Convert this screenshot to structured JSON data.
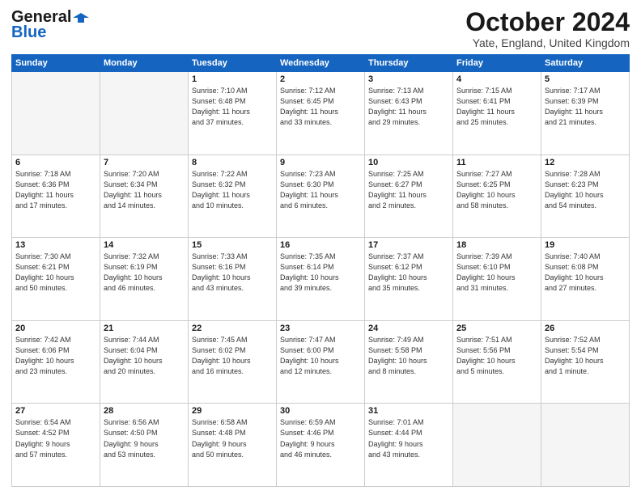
{
  "header": {
    "logo_general": "General",
    "logo_blue": "Blue",
    "month": "October 2024",
    "location": "Yate, England, United Kingdom"
  },
  "days_of_week": [
    "Sunday",
    "Monday",
    "Tuesday",
    "Wednesday",
    "Thursday",
    "Friday",
    "Saturday"
  ],
  "weeks": [
    [
      {
        "day": "",
        "info": ""
      },
      {
        "day": "",
        "info": ""
      },
      {
        "day": "1",
        "info": "Sunrise: 7:10 AM\nSunset: 6:48 PM\nDaylight: 11 hours\nand 37 minutes."
      },
      {
        "day": "2",
        "info": "Sunrise: 7:12 AM\nSunset: 6:45 PM\nDaylight: 11 hours\nand 33 minutes."
      },
      {
        "day": "3",
        "info": "Sunrise: 7:13 AM\nSunset: 6:43 PM\nDaylight: 11 hours\nand 29 minutes."
      },
      {
        "day": "4",
        "info": "Sunrise: 7:15 AM\nSunset: 6:41 PM\nDaylight: 11 hours\nand 25 minutes."
      },
      {
        "day": "5",
        "info": "Sunrise: 7:17 AM\nSunset: 6:39 PM\nDaylight: 11 hours\nand 21 minutes."
      }
    ],
    [
      {
        "day": "6",
        "info": "Sunrise: 7:18 AM\nSunset: 6:36 PM\nDaylight: 11 hours\nand 17 minutes."
      },
      {
        "day": "7",
        "info": "Sunrise: 7:20 AM\nSunset: 6:34 PM\nDaylight: 11 hours\nand 14 minutes."
      },
      {
        "day": "8",
        "info": "Sunrise: 7:22 AM\nSunset: 6:32 PM\nDaylight: 11 hours\nand 10 minutes."
      },
      {
        "day": "9",
        "info": "Sunrise: 7:23 AM\nSunset: 6:30 PM\nDaylight: 11 hours\nand 6 minutes."
      },
      {
        "day": "10",
        "info": "Sunrise: 7:25 AM\nSunset: 6:27 PM\nDaylight: 11 hours\nand 2 minutes."
      },
      {
        "day": "11",
        "info": "Sunrise: 7:27 AM\nSunset: 6:25 PM\nDaylight: 10 hours\nand 58 minutes."
      },
      {
        "day": "12",
        "info": "Sunrise: 7:28 AM\nSunset: 6:23 PM\nDaylight: 10 hours\nand 54 minutes."
      }
    ],
    [
      {
        "day": "13",
        "info": "Sunrise: 7:30 AM\nSunset: 6:21 PM\nDaylight: 10 hours\nand 50 minutes."
      },
      {
        "day": "14",
        "info": "Sunrise: 7:32 AM\nSunset: 6:19 PM\nDaylight: 10 hours\nand 46 minutes."
      },
      {
        "day": "15",
        "info": "Sunrise: 7:33 AM\nSunset: 6:16 PM\nDaylight: 10 hours\nand 43 minutes."
      },
      {
        "day": "16",
        "info": "Sunrise: 7:35 AM\nSunset: 6:14 PM\nDaylight: 10 hours\nand 39 minutes."
      },
      {
        "day": "17",
        "info": "Sunrise: 7:37 AM\nSunset: 6:12 PM\nDaylight: 10 hours\nand 35 minutes."
      },
      {
        "day": "18",
        "info": "Sunrise: 7:39 AM\nSunset: 6:10 PM\nDaylight: 10 hours\nand 31 minutes."
      },
      {
        "day": "19",
        "info": "Sunrise: 7:40 AM\nSunset: 6:08 PM\nDaylight: 10 hours\nand 27 minutes."
      }
    ],
    [
      {
        "day": "20",
        "info": "Sunrise: 7:42 AM\nSunset: 6:06 PM\nDaylight: 10 hours\nand 23 minutes."
      },
      {
        "day": "21",
        "info": "Sunrise: 7:44 AM\nSunset: 6:04 PM\nDaylight: 10 hours\nand 20 minutes."
      },
      {
        "day": "22",
        "info": "Sunrise: 7:45 AM\nSunset: 6:02 PM\nDaylight: 10 hours\nand 16 minutes."
      },
      {
        "day": "23",
        "info": "Sunrise: 7:47 AM\nSunset: 6:00 PM\nDaylight: 10 hours\nand 12 minutes."
      },
      {
        "day": "24",
        "info": "Sunrise: 7:49 AM\nSunset: 5:58 PM\nDaylight: 10 hours\nand 8 minutes."
      },
      {
        "day": "25",
        "info": "Sunrise: 7:51 AM\nSunset: 5:56 PM\nDaylight: 10 hours\nand 5 minutes."
      },
      {
        "day": "26",
        "info": "Sunrise: 7:52 AM\nSunset: 5:54 PM\nDaylight: 10 hours\nand 1 minute."
      }
    ],
    [
      {
        "day": "27",
        "info": "Sunrise: 6:54 AM\nSunset: 4:52 PM\nDaylight: 9 hours\nand 57 minutes."
      },
      {
        "day": "28",
        "info": "Sunrise: 6:56 AM\nSunset: 4:50 PM\nDaylight: 9 hours\nand 53 minutes."
      },
      {
        "day": "29",
        "info": "Sunrise: 6:58 AM\nSunset: 4:48 PM\nDaylight: 9 hours\nand 50 minutes."
      },
      {
        "day": "30",
        "info": "Sunrise: 6:59 AM\nSunset: 4:46 PM\nDaylight: 9 hours\nand 46 minutes."
      },
      {
        "day": "31",
        "info": "Sunrise: 7:01 AM\nSunset: 4:44 PM\nDaylight: 9 hours\nand 43 minutes."
      },
      {
        "day": "",
        "info": ""
      },
      {
        "day": "",
        "info": ""
      }
    ]
  ]
}
